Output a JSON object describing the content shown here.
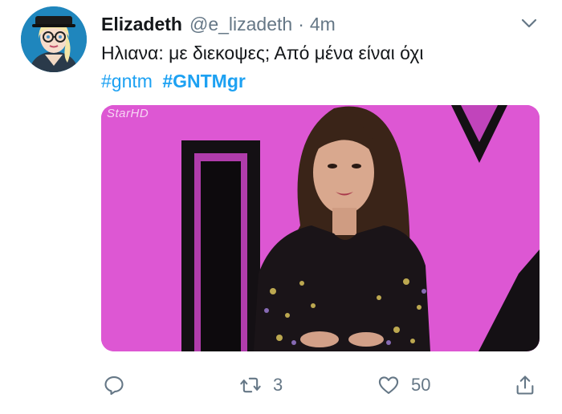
{
  "tweet": {
    "display_name": "Elizadeth",
    "handle": "@e_lizadeth",
    "separator": "·",
    "timestamp": "4m",
    "text": "Ηλιανα: με διεκοψες; Από μένα είναι όχι",
    "hashtags": [
      "#gntm",
      "#GNTMgr"
    ],
    "media_watermark": "StarHD"
  },
  "actions": {
    "reply_count": "",
    "retweet_count": "3",
    "like_count": "50"
  },
  "colors": {
    "link": "#1da1f2",
    "secondary_text": "#657786",
    "media_background": "#e05bd6"
  },
  "icons": [
    "chevron-down-icon",
    "reply-icon",
    "retweet-icon",
    "heart-icon",
    "share-icon"
  ]
}
